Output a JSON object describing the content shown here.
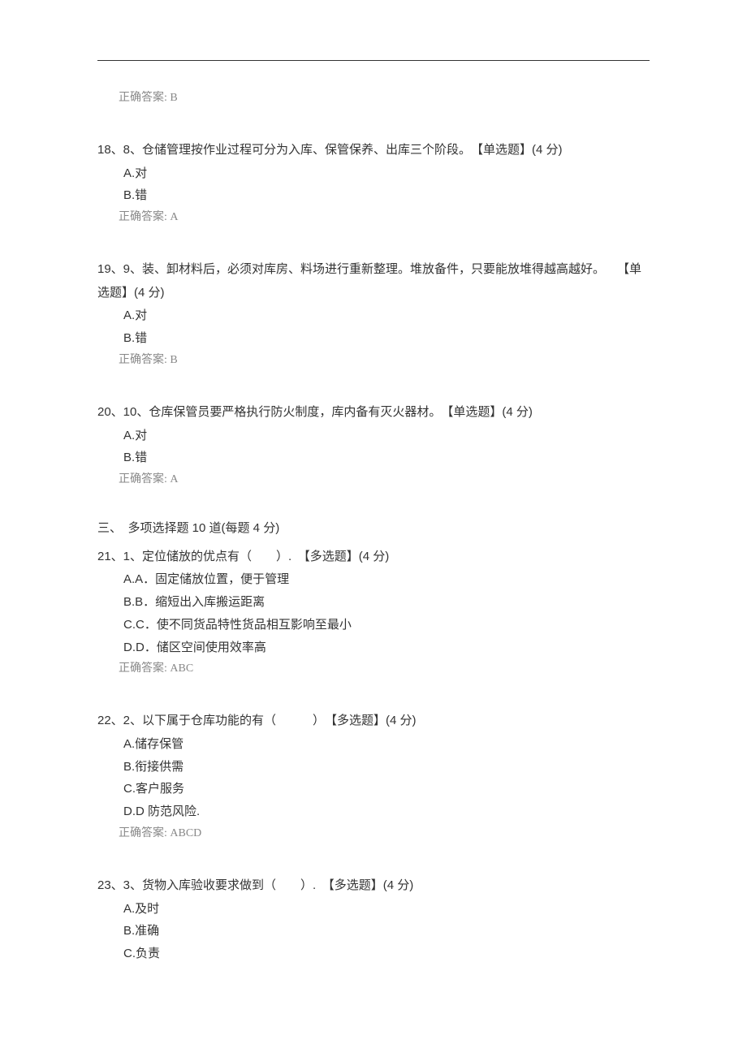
{
  "top_answer": {
    "label": "正确答案:",
    "value": "B"
  },
  "section_header": "三、　多项选择题 10 道(每题 4 分)",
  "questions": [
    {
      "id": "q18",
      "stem": "18、8、仓储管理按作业过程可分为入库、保管保养、出库三个阶段。　【单选题】(4 分)",
      "options": [
        {
          "id": "q18a",
          "text": "A.对"
        },
        {
          "id": "q18b",
          "text": "B.错"
        }
      ],
      "answer": {
        "label": "正确答案:",
        "value": "A"
      }
    },
    {
      "id": "q19",
      "stem": "19、9、装、卸材料后，必须对库房、料场进行重新整理。堆放备件，只要能放堆得越高越好。　　【单选题】(4 分)",
      "options": [
        {
          "id": "q19a",
          "text": "A.对"
        },
        {
          "id": "q19b",
          "text": "B.错"
        }
      ],
      "answer": {
        "label": "正确答案:",
        "value": "B"
      }
    },
    {
      "id": "q20",
      "stem": "20、10、仓库保管员要严格执行防火制度，库内备有灭火器材。　【单选题】(4 分)",
      "options": [
        {
          "id": "q20a",
          "text": "A.对"
        },
        {
          "id": "q20b",
          "text": "B.错"
        }
      ],
      "answer": {
        "label": "正确答案:",
        "value": "A"
      }
    },
    {
      "id": "q21",
      "stem": "21、1、定位储放的优点有（　　）.　【多选题】(4 分)",
      "options": [
        {
          "id": "q21a",
          "text": "A.A．固定储放位置，便于管理"
        },
        {
          "id": "q21b",
          "text": "B.B．缩短出入库搬运距离"
        },
        {
          "id": "q21c",
          "text": "C.C．使不同货品特性货品相互影响至最小"
        },
        {
          "id": "q21d",
          "text": "D.D．储区空间使用效率高"
        }
      ],
      "answer": {
        "label": "正确答案:",
        "value": "ABC"
      }
    },
    {
      "id": "q22",
      "stem": "22、2、以下属于仓库功能的有（　　　）　【多选题】(4 分)",
      "options": [
        {
          "id": "q22a",
          "text": "A.储存保管"
        },
        {
          "id": "q22b",
          "text": "B.衔接供需"
        },
        {
          "id": "q22c",
          "text": "C.客户服务"
        },
        {
          "id": "q22d",
          "text": "D.D 防范风险."
        }
      ],
      "answer": {
        "label": "正确答案:",
        "value": "ABCD"
      }
    },
    {
      "id": "q23",
      "stem": "23、3、货物入库验收要求做到（　　）.　【多选题】(4 分)",
      "options": [
        {
          "id": "q23a",
          "text": "A.及时"
        },
        {
          "id": "q23b",
          "text": "B.准确"
        },
        {
          "id": "q23c",
          "text": "C.负责"
        }
      ],
      "answer": null
    }
  ]
}
